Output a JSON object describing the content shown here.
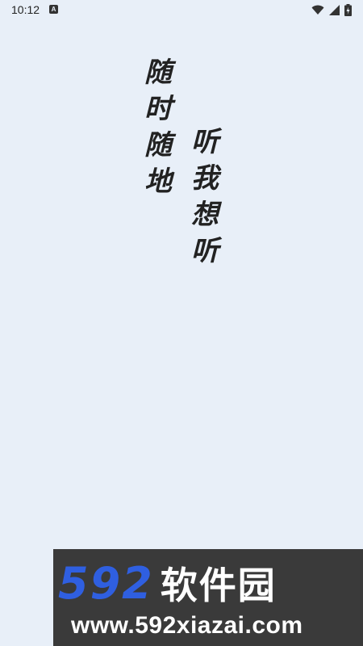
{
  "status_bar": {
    "time": "10:12",
    "notification_badge": "A",
    "icons": [
      "wifi-icon",
      "signal-icon",
      "battery-charging-icon"
    ]
  },
  "slogan": {
    "column_1": [
      "随",
      "时",
      "随",
      "地"
    ],
    "column_2": [
      "听",
      "我",
      "想",
      "听"
    ]
  },
  "watermark": {
    "brand_number": "592",
    "brand_name": "软件园",
    "url": "www.592xiazai.com",
    "colors": {
      "background": "#3a3a3a",
      "number": "#2f5fe0",
      "text": "#ffffff"
    }
  },
  "theme": {
    "background": "#e8eff8",
    "text": "#222222"
  }
}
